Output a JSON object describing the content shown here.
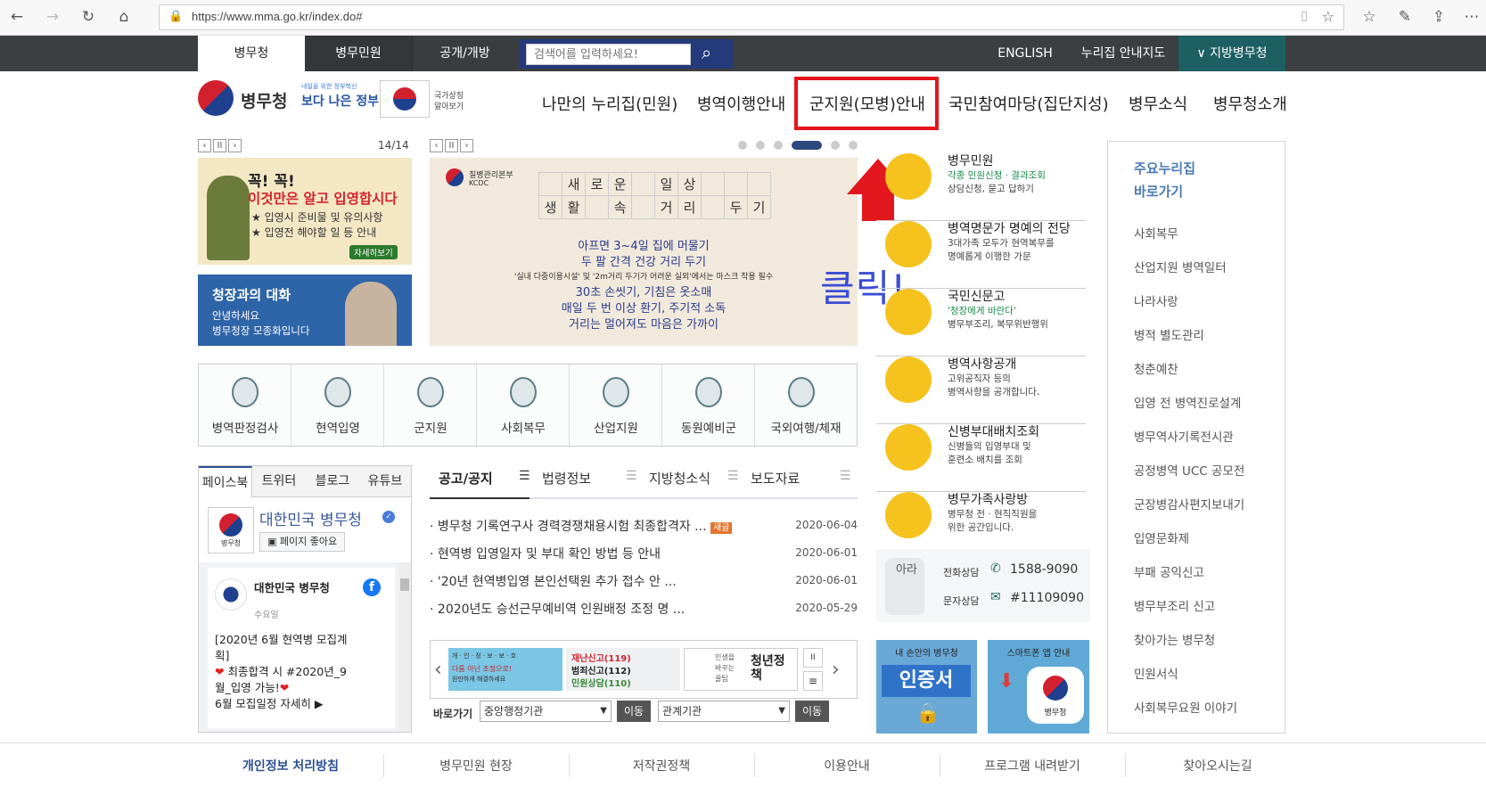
{
  "browser": {
    "url": "https://www.mma.go.kr/index.do#",
    "icons": [
      "back-icon",
      "forward-icon",
      "refresh-icon",
      "home-icon",
      "lock-icon",
      "reader-icon",
      "star-icon",
      "favorites-icon",
      "pen-icon",
      "share-icon",
      "more-icon"
    ]
  },
  "topbar": {
    "tabs": [
      "병무청",
      "병무민원",
      "공개/개방"
    ],
    "search_placeholder": "검색어를 입력하세요!",
    "links": [
      "ENGLISH",
      "누리집 안내지도"
    ],
    "regional": "∨ 지방병무청"
  },
  "header": {
    "logo_text": "병무청",
    "gov_slogan_small": "내일을 위한 정부혁신",
    "gov_slogan": "보다 나은 정부",
    "flag_label_1": "국가상징",
    "flag_label_2": "알아보기",
    "gnb": [
      "나만의 누리집(민원)",
      "병역이행안내",
      "군지원(모병)안내",
      "국민참여마당(집단지성)",
      "병무소식",
      "병무청소개"
    ]
  },
  "annotation": {
    "click_text": "클릭!"
  },
  "left_banner": {
    "page": "14/14",
    "title1": "꼭! 꼭!",
    "title2": "이것만은 알고 입영합시다",
    "item1": "입영시 준비물 및 유의사항",
    "item2": "입영전 해야할 일 등 안내",
    "more": "자세히보기",
    "ceo_title": "청장과의 대화",
    "ceo_line1": "안녕하세요",
    "ceo_line2": "병무청장 모종화입니다"
  },
  "main_banner": {
    "org1": "질병관리본부",
    "org2": "KCDC",
    "grid_row1": [
      "",
      "새",
      "로",
      "운",
      "",
      "일",
      "상",
      ""
    ],
    "grid_row2": [
      "생",
      "활",
      "",
      "속",
      "",
      "거",
      "리",
      "",
      "두",
      "기"
    ],
    "line1": "아프면 3~4일 집에 머물기",
    "line2": "두 팔 간격 건강 거리 두기",
    "line3": "'실내 다중이용시설' 및 '2m거리 두기가 어려운 실외'에서는 마스크 착용 필수",
    "line4": "30초 손씻기, 기침은 옷소매",
    "line5": "매일 두 번 이상 환기, 주기적 소독",
    "line6": "거리는 멀어져도 마음은 가까이"
  },
  "quick_icons": [
    "병역판정검사",
    "현역입영",
    "군지원",
    "사회복무",
    "산업지원",
    "동원예비군",
    "국외여행/체재"
  ],
  "side_services": [
    {
      "title": "병무민원",
      "sub1": "각종 민원신청 · 결과조회",
      "sub2": "상담신청, 묻고 답하기"
    },
    {
      "title": "병역명문가 명예의 전당",
      "sub1": "3대가족 모두가 현역복무를",
      "sub2": "명예롭게 이행한 가문"
    },
    {
      "title": "국민신문고",
      "sub1": "'청장에게 바란다'",
      "sub2": "병무부조리, 복무위반행위"
    },
    {
      "title": "병역사항공개",
      "sub1": "고위공직자 등의",
      "sub2": "병역사항을 공개합니다."
    },
    {
      "title": "신병부대배치조회",
      "sub1": "신병들의 입영부대 및",
      "sub2": "훈련소 배치를 조회"
    },
    {
      "title": "병무가족사랑방",
      "sub1": "병무청 전 · 현직직원을",
      "sub2": "위한 공간입니다."
    }
  ],
  "contact": {
    "mascot": "아라",
    "phone_label": "전화상담",
    "phone": "1588-9090",
    "sms_label": "문자상담",
    "sms": "#11109090"
  },
  "promo": {
    "left": "내 손안의 병무청",
    "left_big": "인증서",
    "right": "스마트폰 앱 안내",
    "right_logo": "병무청"
  },
  "right_panel": {
    "heading1": "주요누리집",
    "heading2": "바로가기",
    "items": [
      "사회복무",
      "산업지원 병역일터",
      "나라사랑",
      "병적 별도관리",
      "청춘예찬",
      "입영 전 병역진로설계",
      "병무역사기록전시관",
      "공정병역 UCC 공모전",
      "군장병감사편지보내기",
      "입영문화제",
      "부패 공익신고",
      "병무부조리 신고",
      "찾아가는 병무청",
      "민원서식",
      "사회복무요원 이야기"
    ]
  },
  "sns": {
    "tabs": [
      "페이스북",
      "트위터",
      "블로그",
      "유튜브"
    ],
    "page_name": "대한민국 병무청",
    "like": "페이지 좋아요",
    "logo_label": "병무청",
    "post_author": "대한민국 병무청",
    "post_day": "수요일",
    "post_line1": "[2020년 6월 현역병 모집계",
    "post_line2": "획]",
    "post_line3": "최종합격 시 #2020년_9",
    "post_line4": "월_입영 가능!",
    "post_line5": "6월 모집일정 자세히"
  },
  "notices": {
    "tabs": [
      "공고/공지",
      "법령정보",
      "지방청소식",
      "보도자료"
    ],
    "rows": [
      {
        "title": "병무청 기록연구사 경력경쟁채용시험 최종합격자 ...",
        "badge": "새글",
        "date": "2020-06-04"
      },
      {
        "title": "현역병 입영일자 및 부대 확인 방법 등 안내",
        "badge": "",
        "date": "2020-06-01"
      },
      {
        "title": "'20년 현역병입영 본인선택원 추가 접수 안 ...",
        "badge": "",
        "date": "2020-06-01"
      },
      {
        "title": "2020년도 승선근무예비역 인원배정 조정 명 ...",
        "badge": "",
        "date": "2020-05-29"
      }
    ]
  },
  "banner_row": {
    "b1_line1": "개 · 인 · 정 · 보 · 보 · 호",
    "b1_line2": "다툼 아닌 조정으로!",
    "b1_line3": "원만하게 해결하세요",
    "b2_line1": "재난신고(119)",
    "b2_line2": "범죄신고(112)",
    "b2_line3": "민원상담(110)",
    "b3_small1": "인생을",
    "b3_small2": "바꾸는",
    "b3_small3": "꿀팁",
    "b3_big": "청년정책",
    "goto_label": "바로가기",
    "select1": "중앙행정기관",
    "select2": "관계기관",
    "go": "이동"
  },
  "footer": [
    "개인정보 처리방침",
    "병무민원 현장",
    "저작권정책",
    "이용안내",
    "프로그램 내려받기",
    "찾아오시는길"
  ]
}
